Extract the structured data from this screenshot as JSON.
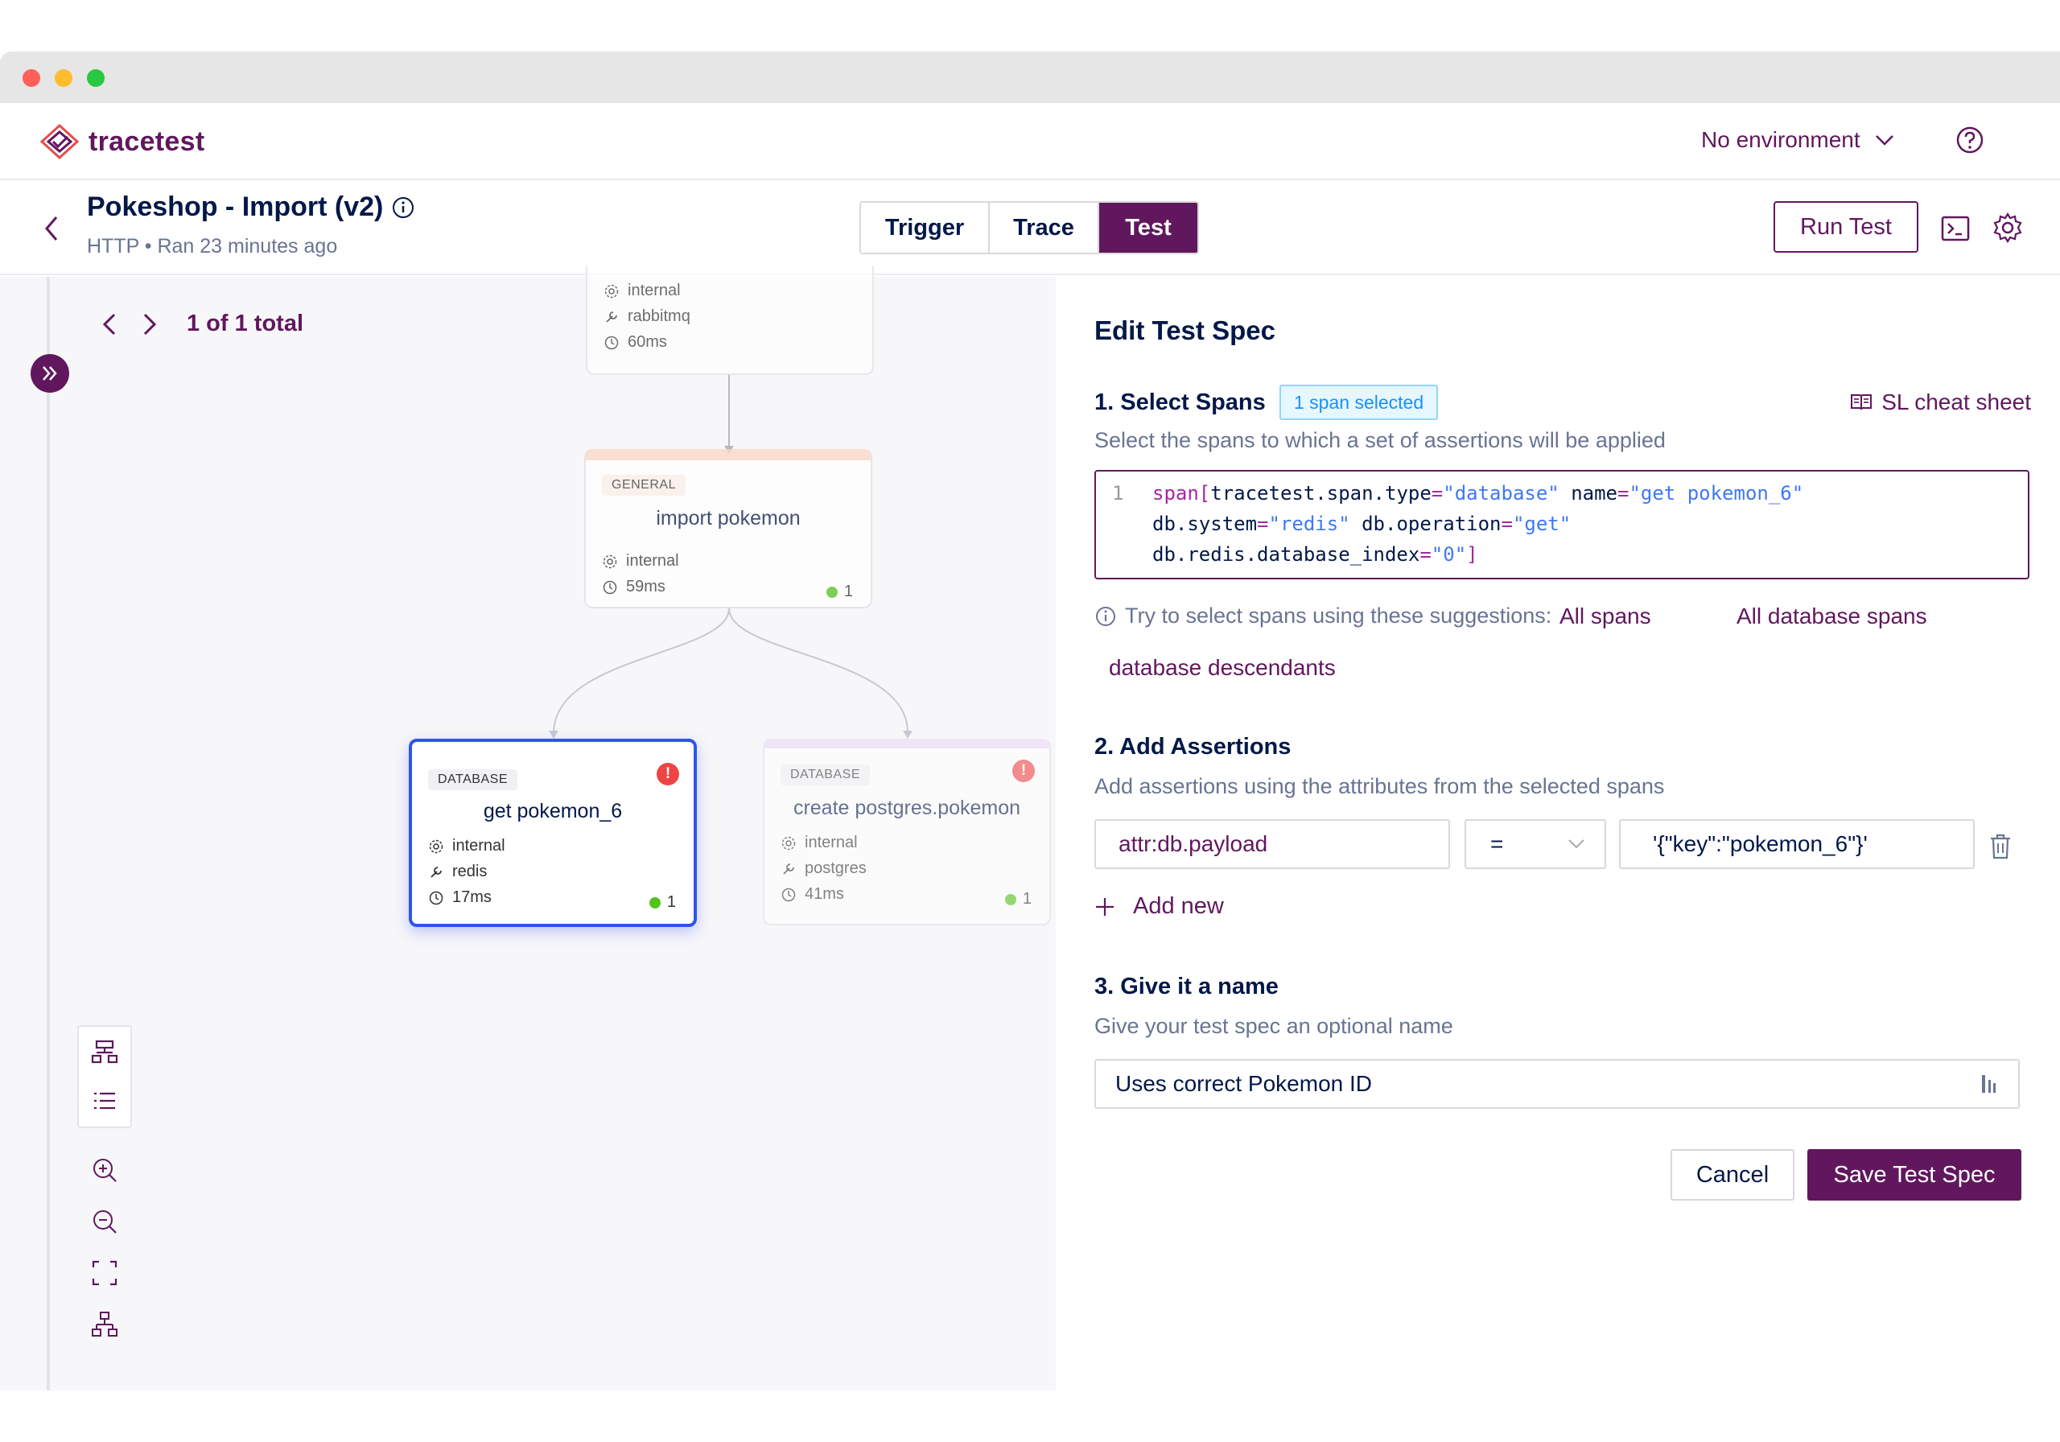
{
  "app": {
    "name": "tracetest",
    "environment": "No environment"
  },
  "test": {
    "title": "Pokeshop - Import (v2)",
    "meta": "HTTP • Ran 23 minutes ago"
  },
  "tabs": [
    {
      "label": "Trigger"
    },
    {
      "label": "Trace"
    },
    {
      "label": "Test",
      "active": true
    }
  ],
  "actions": {
    "run_test": "Run Test"
  },
  "pager": {
    "text": "1 of 1 total"
  },
  "nodes": {
    "rabbit": {
      "attr1": "internal",
      "attr2": "rabbitmq",
      "duration": "60ms"
    },
    "import": {
      "badge": "GENERAL",
      "name": "import pokemon",
      "attr1": "internal",
      "duration": "59ms",
      "count": "1"
    },
    "redis": {
      "badge": "DATABASE",
      "name": "get pokemon_6",
      "attr1": "internal",
      "attr2": "redis",
      "duration": "17ms",
      "count": "1",
      "error": "!"
    },
    "postgres": {
      "badge": "DATABASE",
      "name": "create postgres.pokemon",
      "attr1": "internal",
      "attr2": "postgres",
      "duration": "41ms",
      "count": "1",
      "error": "!"
    }
  },
  "spec": {
    "title": "Edit Test Spec",
    "sec1_title": "1. Select Spans",
    "span_tag": "1 span selected",
    "cheat_sheet": "SL cheat sheet",
    "sec1_sub": "Select the spans to which a set of assertions will be applied",
    "line_no": "1",
    "code": {
      "l1_fn": "span[",
      "l1_k1": "tracetest.span.type",
      "l1_v1": "\"database\"",
      "l1_k2": "name",
      "l1_v2": "\"get pokemon_6\"",
      "l2_k1": "db.system",
      "l2_v1": "\"redis\"",
      "l2_k2": "db.operation",
      "l2_v2": "\"get\"",
      "l3_k1": "db.redis.database_index",
      "l3_v1": "\"0\"",
      "l3_end": "]",
      "eq": "="
    },
    "hint": "Try to select spans using these suggestions:",
    "suggestions": [
      "All spans",
      "All database spans",
      "database descendants"
    ],
    "sec2_title": "2. Add Assertions",
    "sec2_sub": "Add assertions using the attributes from the selected spans",
    "assertion": {
      "attr": "attr:db.payload",
      "operator": "=",
      "value": "'{\"key\":\"pokemon_6\"}'"
    },
    "add_new": "Add new",
    "sec3_title": "3. Give it a name",
    "sec3_sub": "Give your test spec an optional name",
    "name_value": "Uses correct Pokemon ID",
    "cancel": "Cancel",
    "save": "Save Test Spec"
  },
  "colors": {
    "brand": "#61175e",
    "text": "#031849",
    "muted": "#687492",
    "selected_border": "#2f54eb",
    "error": "#ef4444",
    "success": "#52c41a"
  }
}
